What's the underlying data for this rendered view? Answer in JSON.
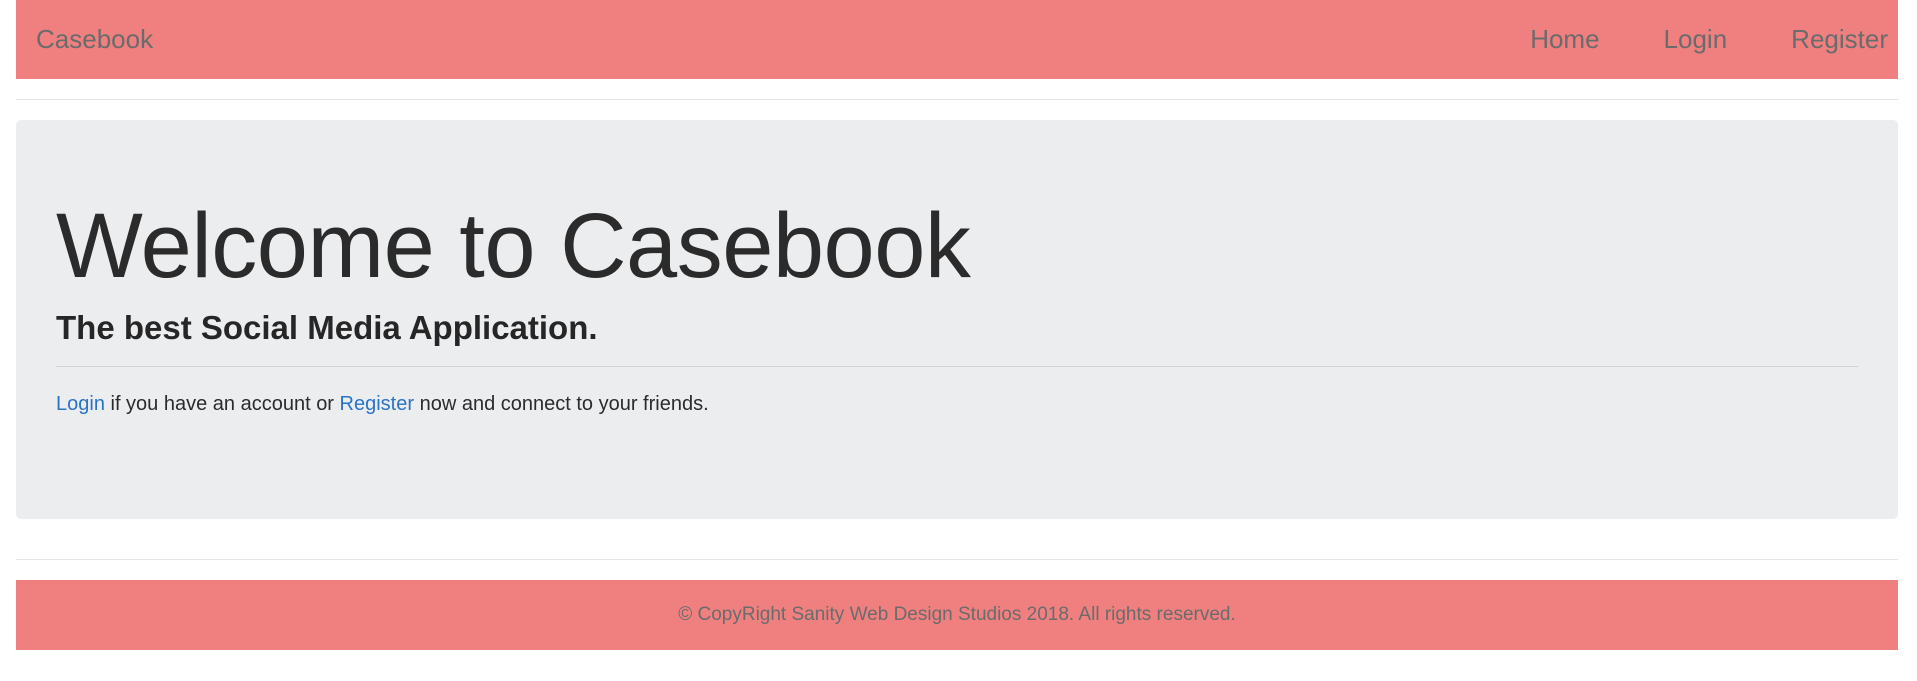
{
  "navbar": {
    "brand": "Casebook",
    "links": [
      {
        "label": "Home"
      },
      {
        "label": "Login"
      },
      {
        "label": "Register"
      }
    ],
    "background": "#f08080"
  },
  "jumbotron": {
    "title": "Welcome to Casebook",
    "subtitle": "The best Social Media Application.",
    "login_link": "Login",
    "text_middle": " if you have an account or ",
    "register_link": "Register",
    "text_end": " now and connect to your friends.",
    "background": "#ecedef",
    "link_color": "#2a73c5"
  },
  "footer": {
    "text": "© CopyRight Sanity Web Design Studios 2018. All rights reserved."
  }
}
